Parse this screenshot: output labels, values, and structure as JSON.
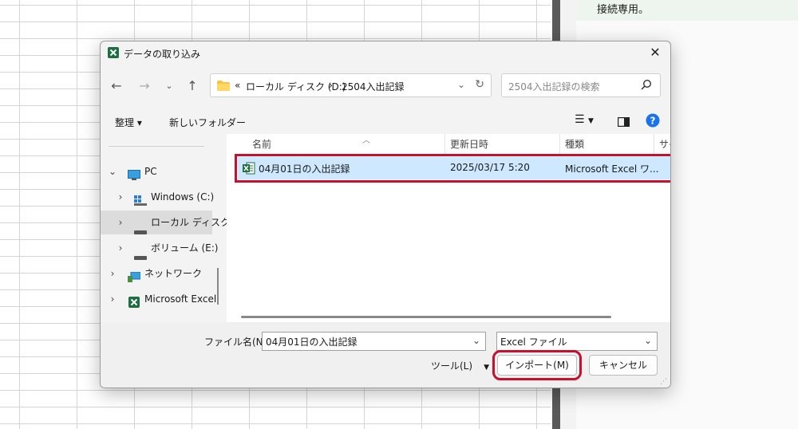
{
  "side_panel": {
    "note": "接続専用。"
  },
  "dialog": {
    "title": "データの取り込み",
    "address": {
      "prefix": "«",
      "crumbs": [
        "ローカル ディスク (D:)",
        "2504入出記録"
      ],
      "separator": "›"
    },
    "search": {
      "placeholder": "2504入出記録の検索"
    },
    "toolbar": {
      "organize": "整理 ▾",
      "new_folder": "新しいフォルダー"
    },
    "nav_pane": {
      "items": [
        {
          "label": "PC",
          "expanded": true
        },
        {
          "label": "Windows (C:)"
        },
        {
          "label": "ローカル ディスク",
          "selected": true
        },
        {
          "label": "ボリューム (E:)"
        },
        {
          "label": "ネットワーク"
        },
        {
          "label": "Microsoft Excel"
        }
      ]
    },
    "columns": [
      "名前",
      "更新日時",
      "種類",
      "サイ"
    ],
    "files": [
      {
        "name": "04月01日の入出記録",
        "modified": "2025/03/17 5:20",
        "type": "Microsoft Excel ワ..."
      }
    ],
    "footer": {
      "file_name_label": "ファイル名(N):",
      "file_name_value": "04月01日の入出記録",
      "file_type": "Excel ファイル",
      "tools_label": "ツール(L)",
      "import_label": "インポート(M)",
      "cancel_label": "キャンセル"
    }
  },
  "colors": {
    "highlight_box": "#c8102e",
    "selection": "#cde8ff",
    "excel_green": "#1d6f42"
  }
}
